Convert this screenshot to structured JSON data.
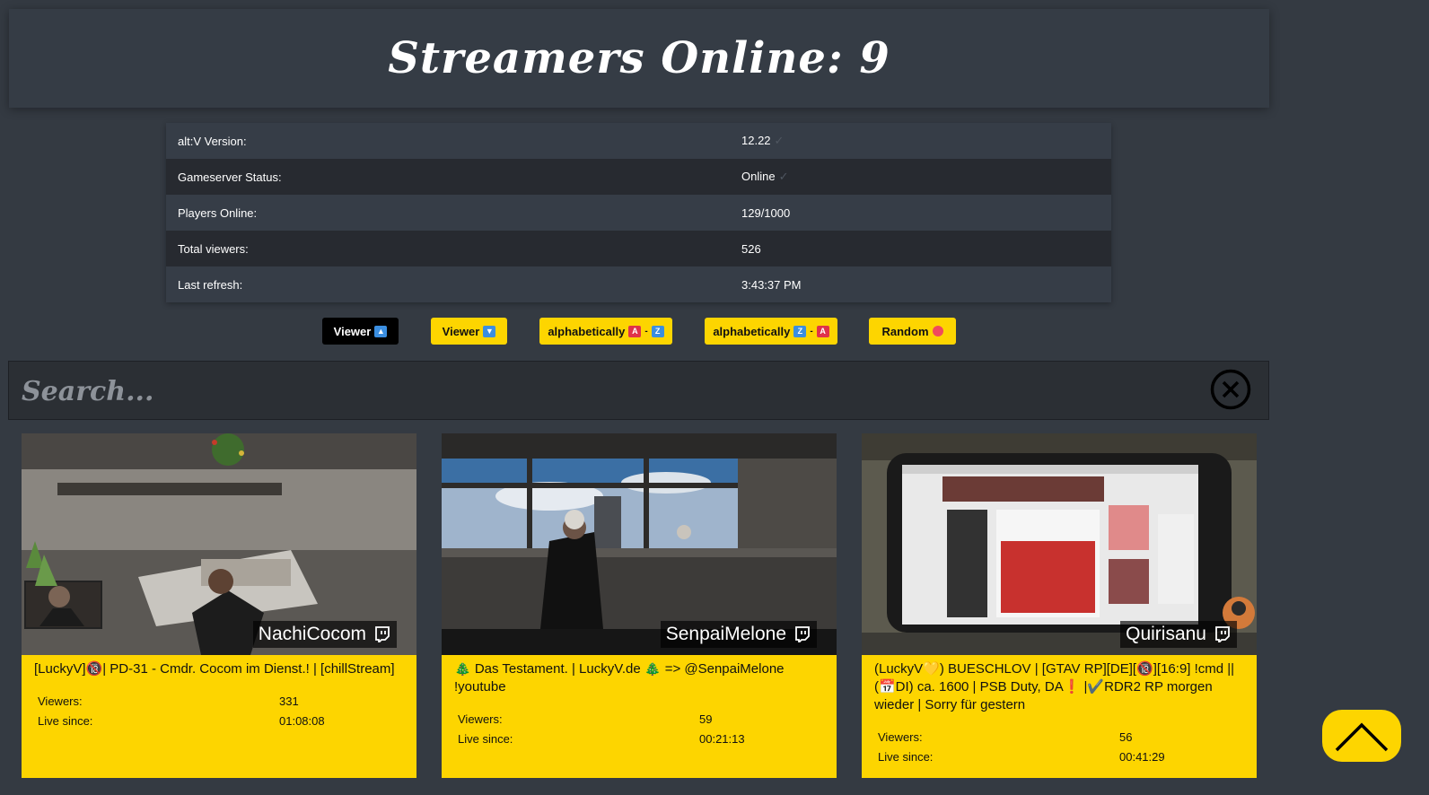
{
  "header": {
    "title": "Streamers Online: 9"
  },
  "info": {
    "rows": [
      {
        "label": "alt:V Version:",
        "value": "12.22",
        "check": true
      },
      {
        "label": "Gameserver Status:",
        "value": "Online",
        "check": true
      },
      {
        "label": "Players Online:",
        "value": "129/1000",
        "check": false
      },
      {
        "label": "Total viewers:",
        "value": "526",
        "check": false
      },
      {
        "label": "Last refresh:",
        "value": "3:43:37 PM",
        "check": false
      }
    ],
    "check_glyph": "✓"
  },
  "sort": {
    "viewer_up": "Viewer",
    "viewer_down": "Viewer",
    "alpha_az": "alphabetically",
    "alpha_za": "alphabetically",
    "random": "Random",
    "active": "viewer_up"
  },
  "search": {
    "placeholder": "Search..."
  },
  "cards": [
    {
      "name": "NachiCocom",
      "title": "[LuckyV]🔞| PD-31 - Cmdr. Cocom im Dienst.! | [chillStream]",
      "viewers_label": "Viewers:",
      "viewers": "331",
      "live_label": "Live since:",
      "live": "01:08:08"
    },
    {
      "name": "SenpaiMelone",
      "title": "🎄 Das Testament. | LuckyV.de 🎄 => @SenpaiMelone !youtube",
      "viewers_label": "Viewers:",
      "viewers": "59",
      "live_label": "Live since:",
      "live": "00:21:13"
    },
    {
      "name": "Quirisanu",
      "title": "(LuckyV💛) BUESCHLOV | [GTAV RP][DE][🔞][16:9] !cmd || (📅DI) ca. 1600 | PSB Duty, DA❗ |✔️RDR2 RP morgen wieder | Sorry für gestern",
      "viewers_label": "Viewers:",
      "viewers": "56",
      "live_label": "Live since:",
      "live": "00:41:29"
    }
  ],
  "colors": {
    "accent": "#fdd500",
    "background": "#343a42",
    "active_button": "#000000"
  }
}
